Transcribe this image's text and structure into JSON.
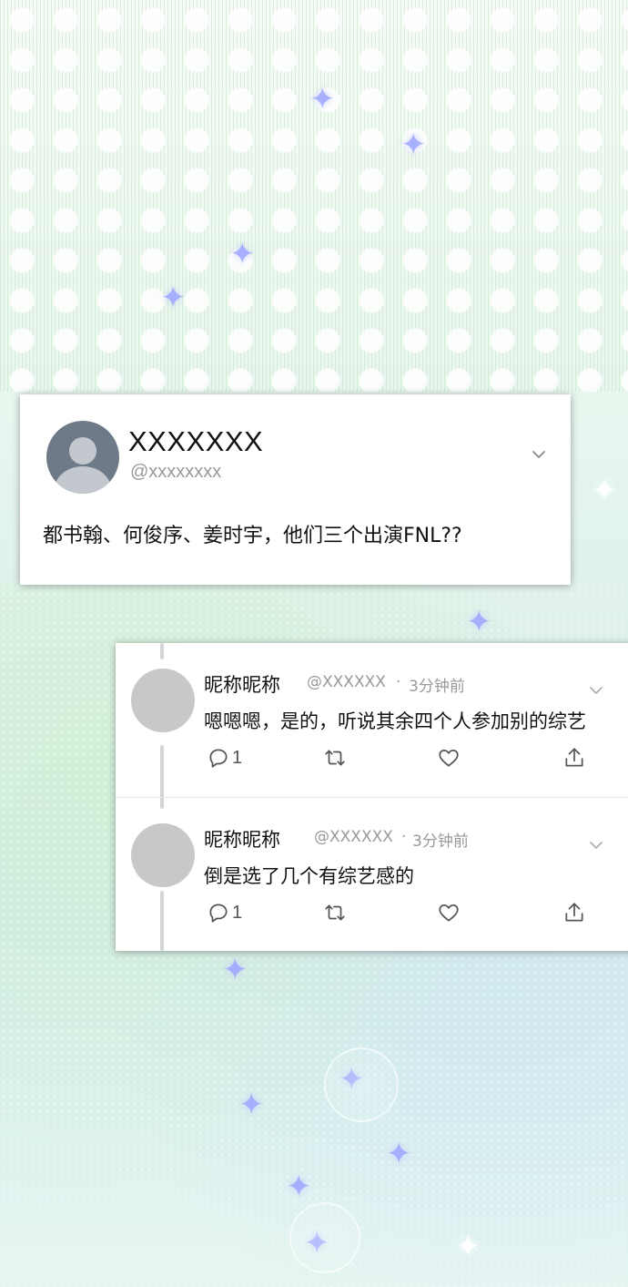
{
  "main_tweet": {
    "display_name": "XXXXXXX",
    "handle": "@xxxxxxxx",
    "text": "都书翰、何俊序、姜时宇，他们三个出演FNL??",
    "avatar_icon": "default-avatar-icon",
    "menu_icon": "chevron-down-icon"
  },
  "replies": [
    {
      "display_name": "昵称昵称",
      "handle": "@XXXXXX",
      "separator": "·",
      "time": "3分钟前",
      "text": "嗯嗯嗯，是的，听说其余四个人参加别的综艺",
      "reply_count": "1",
      "icons": [
        "comment-icon",
        "retweet-icon",
        "heart-icon",
        "share-icon"
      ]
    },
    {
      "display_name": "昵称昵称",
      "handle": "@XXXXXX",
      "separator": "·",
      "time": "3分钟前",
      "text": "倒是选了几个有综艺感的",
      "reply_count": "1",
      "icons": [
        "comment-icon",
        "retweet-icon",
        "heart-icon",
        "share-icon"
      ]
    }
  ]
}
